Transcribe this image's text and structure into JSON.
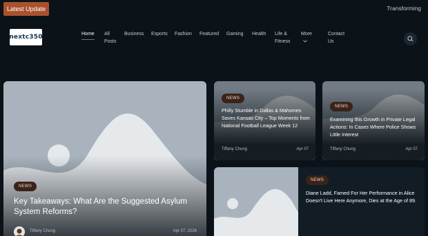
{
  "ticker": {
    "label": "Latest Update",
    "headline": "Transforming"
  },
  "logo": {
    "text": "nextc350"
  },
  "nav": {
    "items": [
      {
        "label": "Home",
        "active": true
      },
      {
        "label": "All Posts"
      },
      {
        "label": "Business"
      },
      {
        "label": "Esports"
      },
      {
        "label": "Fashion"
      },
      {
        "label": "Featured"
      },
      {
        "label": "Gaming"
      },
      {
        "label": "Health"
      },
      {
        "label": "Life & Fitness"
      },
      {
        "label": "More"
      },
      {
        "label": "Contact Us"
      }
    ]
  },
  "icons": {
    "search": "search-icon",
    "more": "chevron-down-icon",
    "placeholder": "image-placeholder-icon"
  },
  "featured": {
    "badge": "NEWS",
    "title": "Key Takeaways: What Are the Suggested Asylum System Reforms?",
    "author": "Tiffany Chung",
    "date": "Apr 07, 2026"
  },
  "cards": [
    {
      "badge": "NEWS",
      "title": "Philly Stumble in Dallas & Mahomes Saves Kansas City – Top Moments from National Football League Week 12",
      "author": "Tiffany Chung",
      "date": "Apr 07"
    },
    {
      "badge": "NEWS",
      "title": "Examining this Growth in Private Legal Actions: In Cases Where Police Shows Little Interest",
      "author": "Tiffany Chung",
      "date": "Apr 07"
    },
    {
      "badge": "NEWS",
      "title": "Diane Ladd, Famed For Her Performance in Alice Doesn't Live Here Anymore, Dies at the Age of 89."
    }
  ],
  "colors": {
    "background": "#0b1218",
    "accent": "#a8522d",
    "placeholder_bg": "#a9b3bd",
    "placeholder_shape": "#e6e9ec"
  }
}
